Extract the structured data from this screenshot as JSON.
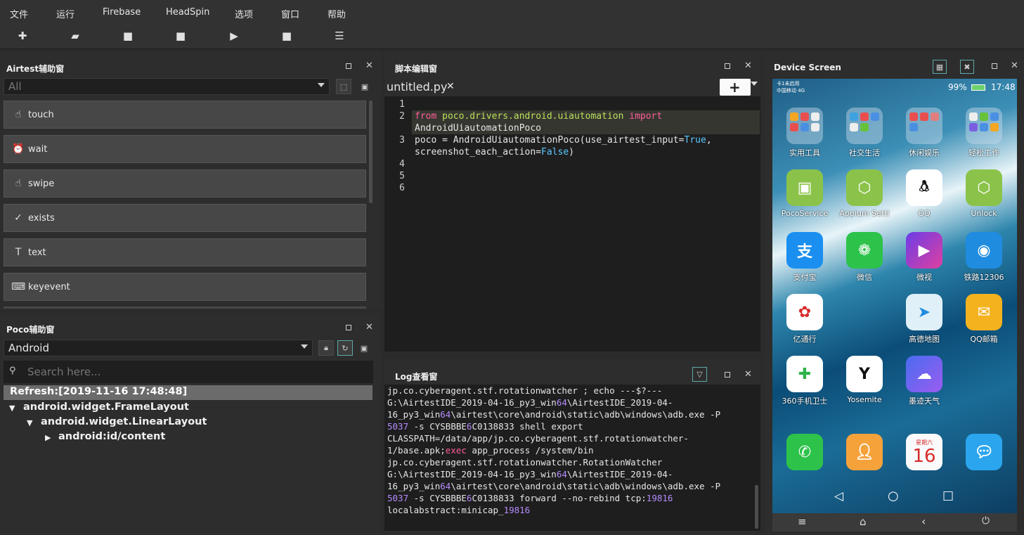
{
  "menu": [
    "文件",
    "运行",
    "Firebase",
    "HeadSpin",
    "选项",
    "窗口",
    "帮助"
  ],
  "toolbar": {
    "icons": [
      "new-file-icon",
      "open-folder-icon",
      "save-icon",
      "save-as-icon",
      "run-icon",
      "stop-icon",
      "log-icon"
    ],
    "glyphs": [
      "✚",
      "▰",
      "■",
      "■",
      "▶",
      "■",
      "☰"
    ]
  },
  "airtest_panel": {
    "title": "Airtest辅助窗",
    "dropdown_value": "All",
    "buttons": [
      {
        "label": "touch",
        "icon": "hand-icon",
        "glyph": "☝"
      },
      {
        "label": "wait",
        "icon": "clock-icon",
        "glyph": "⏰"
      },
      {
        "label": "swipe",
        "icon": "swipe-icon",
        "glyph": "☝"
      },
      {
        "label": "exists",
        "icon": "check-circle-icon",
        "glyph": "✓"
      },
      {
        "label": "text",
        "icon": "text-box-icon",
        "glyph": "T"
      },
      {
        "label": "keyevent",
        "icon": "keyboard-icon",
        "glyph": "⌨"
      }
    ]
  },
  "poco_panel": {
    "title": "Poco辅助窗",
    "dropdown_value": "Android",
    "search_placeholder": "Search here...",
    "refresh_label": "Refresh:[2019-11-16 17:48:48]",
    "tree": [
      {
        "arrow": "▼",
        "label": "android.widget.FrameLayout"
      },
      {
        "arrow": "▼",
        "label": "android.widget.LinearLayout"
      },
      {
        "arrow": "▶",
        "label": "android:id/content"
      }
    ]
  },
  "editor": {
    "title": "脚本编辑窗",
    "tab_label": "untitled.py",
    "line_numbers": [
      "1",
      "2",
      "3",
      "4",
      "5",
      "6"
    ]
  },
  "log_panel": {
    "title": "Log查看窗"
  },
  "device": {
    "title": "Device Screen",
    "status_left_top": "卡1未启用",
    "status_left_bottom": "中国移动 4G",
    "battery": "99%",
    "time": "17:48",
    "apps": [
      {
        "name": "实用工具"
      },
      {
        "name": "社交生活"
      },
      {
        "name": "休闲娱乐"
      },
      {
        "name": "轻松工作"
      },
      {
        "name": "PocoService"
      },
      {
        "name": "Appium Setti"
      },
      {
        "name": "QQ"
      },
      {
        "name": "Unlock"
      },
      {
        "name": "支付宝"
      },
      {
        "name": "微信"
      },
      {
        "name": "微视"
      },
      {
        "name": "铁路12306"
      },
      {
        "name": "亿通行"
      },
      {
        "name": "高德地图"
      },
      {
        "name": "QQ邮箱"
      },
      {
        "name": "360手机卫士"
      },
      {
        "name": "Yosemite"
      },
      {
        "name": "墨迹天气"
      }
    ],
    "calendar_weekday": "星期六",
    "calendar_day": "16"
  }
}
